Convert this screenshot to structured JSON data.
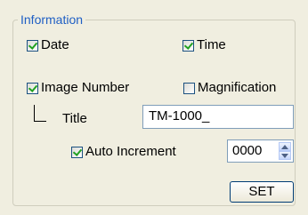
{
  "group": {
    "title": "Information"
  },
  "options": {
    "date": {
      "label": "Date",
      "checked": true
    },
    "time": {
      "label": "Time",
      "checked": true
    },
    "image_number": {
      "label": "Image Number",
      "checked": true
    },
    "magnification": {
      "label": "Magnification",
      "checked": false
    },
    "auto_increment": {
      "label": "Auto Increment",
      "checked": true
    }
  },
  "title_field": {
    "label": "Title",
    "value": "TM-1000_"
  },
  "increment_spinner": {
    "value": "0000"
  },
  "set_button": {
    "label": "SET"
  },
  "colors": {
    "group_title": "#1f5fc4",
    "checkmark": "#21a121",
    "background": "#f0eee0"
  },
  "icons": {
    "spin_up": "spin-up-arrow-icon",
    "spin_down": "spin-down-arrow-icon"
  }
}
